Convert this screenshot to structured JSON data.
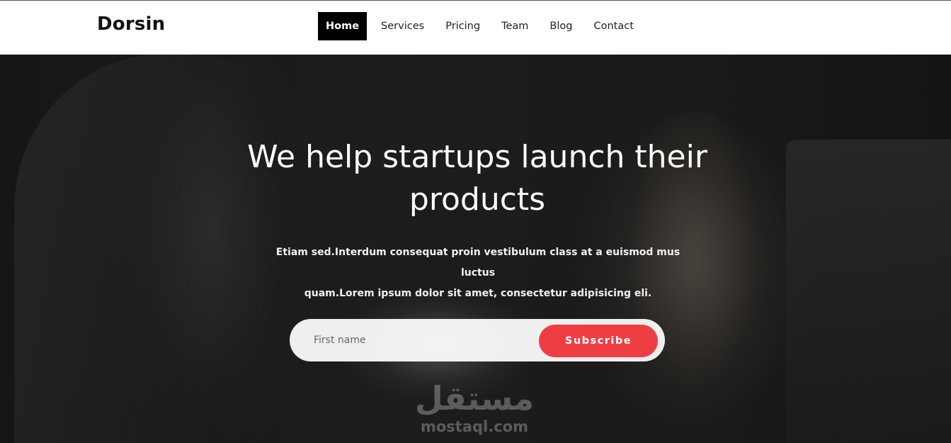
{
  "header": {
    "brand": "Dorsin",
    "nav": [
      {
        "label": "Home",
        "active": true
      },
      {
        "label": "Services",
        "active": false
      },
      {
        "label": "Pricing",
        "active": false
      },
      {
        "label": "Team",
        "active": false
      },
      {
        "label": "Blog",
        "active": false
      },
      {
        "label": "Contact",
        "active": false
      }
    ]
  },
  "hero": {
    "title_line1": "We help startups launch their",
    "title_line2": "products",
    "description_line1": "Etiam sed.Interdum consequat proin vestibulum class at a euismod mus luctus",
    "description_line2": "quam.Lorem ipsum dolor sit amet, consectetur adipisicing eli.",
    "form": {
      "placeholder": "First name",
      "value": "",
      "button_label": "Subscribe"
    }
  },
  "watermark": {
    "arabic": "مستقل",
    "latin": "mostaql.com"
  },
  "colors": {
    "accent": "#ef3e43",
    "nav_active_bg": "#000000",
    "header_bg": "#ffffff",
    "hero_text": "#ffffff"
  }
}
